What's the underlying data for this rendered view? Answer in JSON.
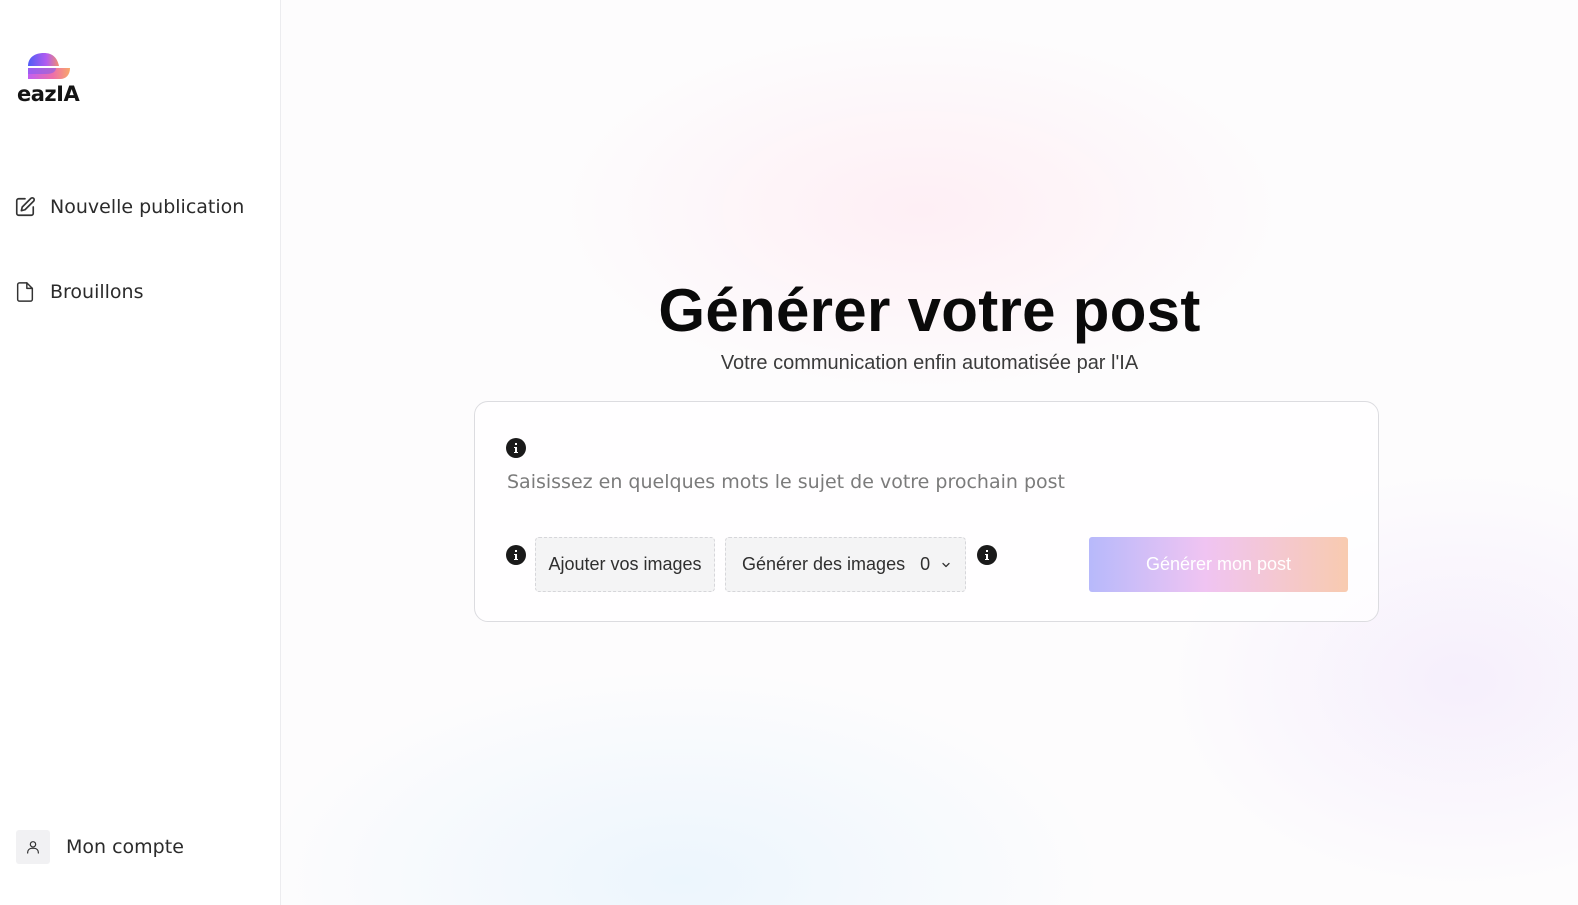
{
  "brand": {
    "name": "eazIA",
    "logo_icon": "eazia-logo"
  },
  "sidebar": {
    "items": [
      {
        "label": "Nouvelle publication",
        "icon": "edit-square-icon"
      },
      {
        "label": "Brouillons",
        "icon": "file-icon"
      }
    ],
    "account": {
      "label": "Mon compte",
      "icon": "user-icon"
    }
  },
  "main": {
    "title": "Générer votre post",
    "subtitle": "Votre communication enfin automatisée par l'IA",
    "form": {
      "prompt_placeholder": "Saisissez en quelques mots le sujet de votre prochain post",
      "prompt_value": "",
      "add_images_label": "Ajouter vos images",
      "generate_images_label": "Générer des images",
      "generate_images_count": "0",
      "submit_label": "Générer mon post"
    }
  },
  "colors": {
    "submit_gradient": [
      "#b7b9fb",
      "#f0c4f2",
      "#f8cbb0"
    ],
    "logo_gradient": [
      "#5b5ff5",
      "#c95cf0",
      "#f59a6b"
    ]
  }
}
